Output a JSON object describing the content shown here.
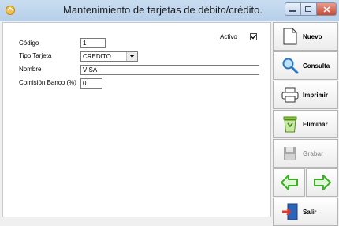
{
  "window": {
    "title": "Mantenimiento de tarjetas de débito/crédito."
  },
  "form": {
    "codigo_label": "Código",
    "codigo_value": "1",
    "tipo_label": "Tipo Tarjeta",
    "tipo_value": "CREDITO",
    "nombre_label": "Nombre",
    "nombre_value": "VISA",
    "comision_label": "Comisión Banco (%)",
    "comision_value": "0",
    "activo_label": "Activo",
    "activo_checked": true
  },
  "toolbar": {
    "nuevo": "Nuevo",
    "consulta": "Consulta",
    "imprimir": "Imprimir",
    "eliminar": "Eliminar",
    "grabar": "Grabar",
    "salir": "Salir"
  },
  "icons": {
    "nuevo": "new-document-icon",
    "consulta": "magnifier-icon",
    "imprimir": "printer-icon",
    "eliminar": "recycle-bin-icon",
    "grabar": "floppy-disk-icon",
    "anterior": "arrow-left-icon",
    "siguiente": "arrow-right-icon",
    "salir": "exit-door-icon"
  },
  "colors": {
    "arrow_green": "#3fae29",
    "title_bar": "#c9ddf1"
  }
}
